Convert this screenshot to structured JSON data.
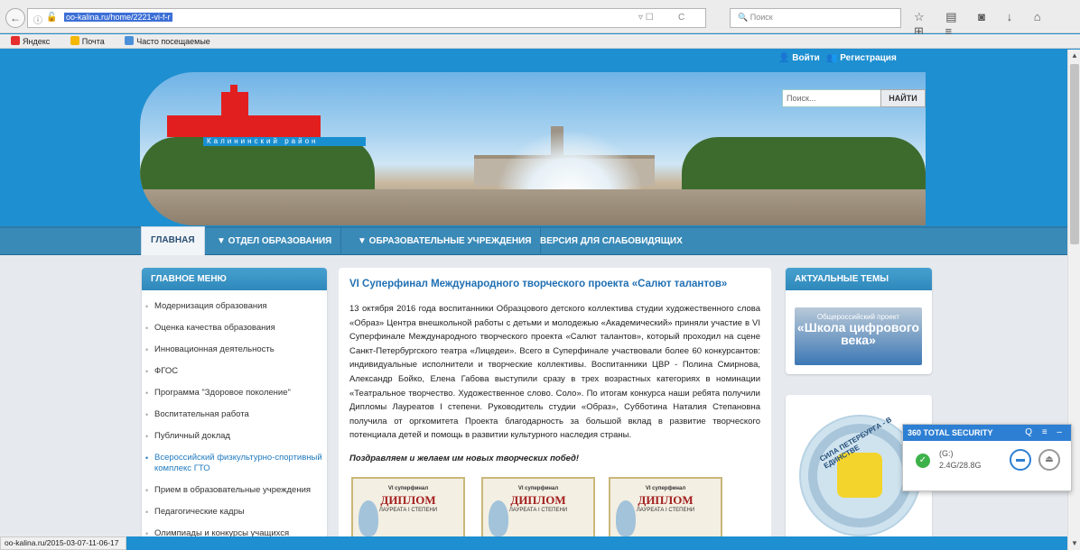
{
  "browser": {
    "url": "oo-kalina.ru/home/2221-vi-f-r",
    "search_placeholder": "Поиск",
    "bookmarks": [
      {
        "label": "Яндекс",
        "color": "#e62e2e"
      },
      {
        "label": "Почта",
        "color": "#f5b700"
      },
      {
        "label": "Часто посещаемые",
        "color": "#4a90d9"
      }
    ],
    "status_url": "oo-kalina.ru/2015-03-07-11-06-17"
  },
  "header": {
    "login": "Войти",
    "register": "Регистрация",
    "search_placeholder": "Поиск...",
    "search_button": "НАЙТИ",
    "district_ribbon": "Калининский район"
  },
  "nav": {
    "items": [
      {
        "label": "ГЛАВНАЯ"
      },
      {
        "label": "▼ ОТДЕЛ ОБРАЗОВАНИЯ"
      },
      {
        "label": "▼ ОБРАЗОВАТЕЛЬНЫЕ УЧРЕЖДЕНИЯ"
      },
      {
        "label": "ВЕРСИЯ ДЛЯ СЛАБОВИДЯЩИХ"
      }
    ]
  },
  "main_menu": {
    "title": "ГЛАВНОЕ МЕНЮ",
    "items": [
      "Модернизация образования",
      "Оценка качества образования",
      "Инновационная деятельность",
      "ФГОС",
      "Программа \"Здоровое поколение\"",
      "Воспитательная работа",
      "Публичный доклад",
      "Всероссийский физкультурно-спортивный комплекс ГТО",
      "Прием в образовательные учреждения",
      "Педагогические кадры",
      "Олимпиады и конкурсы учащихся"
    ]
  },
  "article": {
    "title": "VI Суперфинал Международного творческого проекта «Салют талантов»",
    "p1": "13 октября 2016 года воспитанники Образцового детского коллектива студии художественного слова «Образ» Центра внешкольной работы с детьми и молодежью «Академический» приняли участие в VI Суперфинале Международного творческого проекта «Салют талантов», который проходил на сцене Санкт-Петербургского театра «Лицедеи». Всего в Суперфинале участвовали более 60 конкурсантов: индивидуальные исполнители и творческие коллективы. Воспитанники ЦВР - Полина Смирнова, Александр Бойко, Елена Габова выступили сразу в трех возрастных категориях в номинации «Театральное творчество. Художественное слово. Соло». По итогам конкурса наши ребята получили Дипломы Лауреатов I степени. Руководитель студии «Образ», Субботина Наталия Степановна получила от оргкомитета Проекта благодарность за большой вклад в развитие творческого потенциала детей и помощь в развитии культурного наследия страны.",
    "congrats": "Поздравляем и желаем им новых творческих побед!",
    "diploma_header": "VI суперфинал",
    "diploma_word": "ДИПЛОМ",
    "diploma_sub": "ЛАУРЕАТА I СТЕПЕНИ"
  },
  "topics": {
    "title": "АКТУАЛЬНЫЕ ТЕМЫ",
    "promo_top": "Общероссийский проект",
    "promo_main": "«Школа цифрового века»",
    "medal_text": "СИЛА ПЕТЕРБУРГА - В ЕДИНСТВЕ"
  },
  "widget": {
    "title": "360 TOTAL SECURITY",
    "drive": "(G:)",
    "usage": "2.4G/28.8G"
  }
}
